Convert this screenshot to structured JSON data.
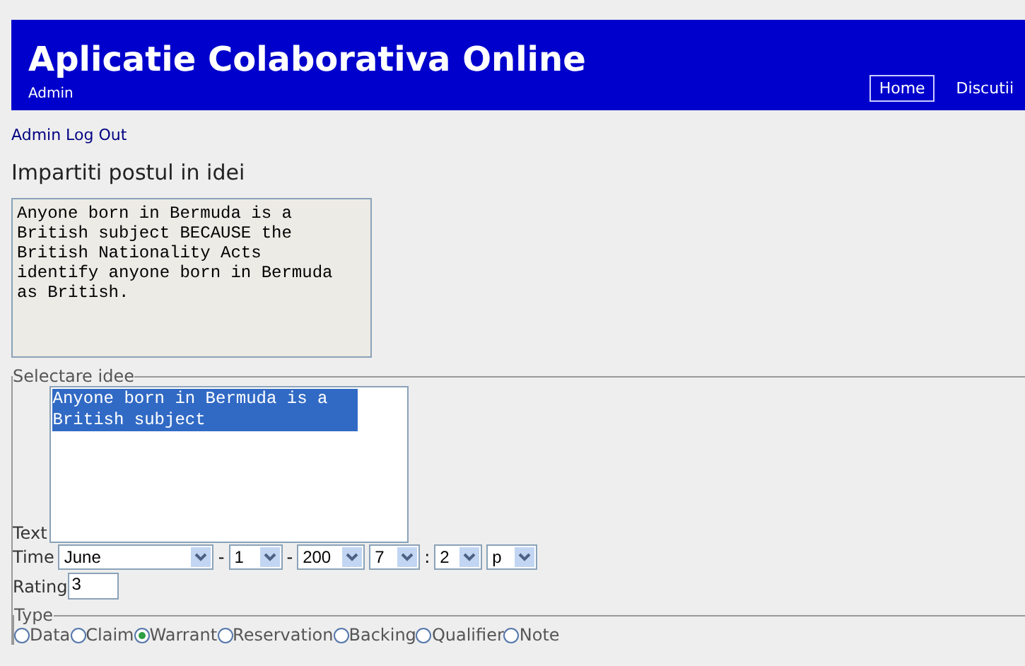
{
  "header": {
    "title": "Aplicatie Colaborativa Online",
    "user": "Admin",
    "nav": [
      {
        "label": "Home",
        "selected": true
      },
      {
        "label": "Discutii",
        "selected": false
      }
    ]
  },
  "logout_link": "Admin Log Out",
  "heading": "Impartiti postul in idei",
  "post_text": "Anyone born in Bermuda is a British subject BECAUSE the British Nationality Acts identify anyone born in Bermuda as British.",
  "select_idea": {
    "legend": "Selectare idee",
    "text_label": "Text",
    "ideas": [
      {
        "text": "Anyone born in Bermuda is a British subject",
        "selected": true
      }
    ],
    "time_label": "Time",
    "time_parts": [
      {
        "value": "June"
      },
      {
        "sep": "-",
        "value": "1"
      },
      {
        "sep": "-",
        "value": "200"
      },
      {
        "value": "7"
      },
      {
        "sep": ":",
        "value": "2"
      },
      {
        "value": "p"
      }
    ],
    "rating_label": "Rating",
    "rating": "3"
  },
  "type": {
    "legend": "Type",
    "options": [
      {
        "label": "Data",
        "selected": false
      },
      {
        "label": "Claim",
        "selected": false
      },
      {
        "label": "Warrant",
        "selected": true
      },
      {
        "label": "Reservation",
        "selected": false
      },
      {
        "label": "Backing",
        "selected": false
      },
      {
        "label": "Qualifier",
        "selected": false
      },
      {
        "label": "Note",
        "selected": false
      }
    ]
  }
}
